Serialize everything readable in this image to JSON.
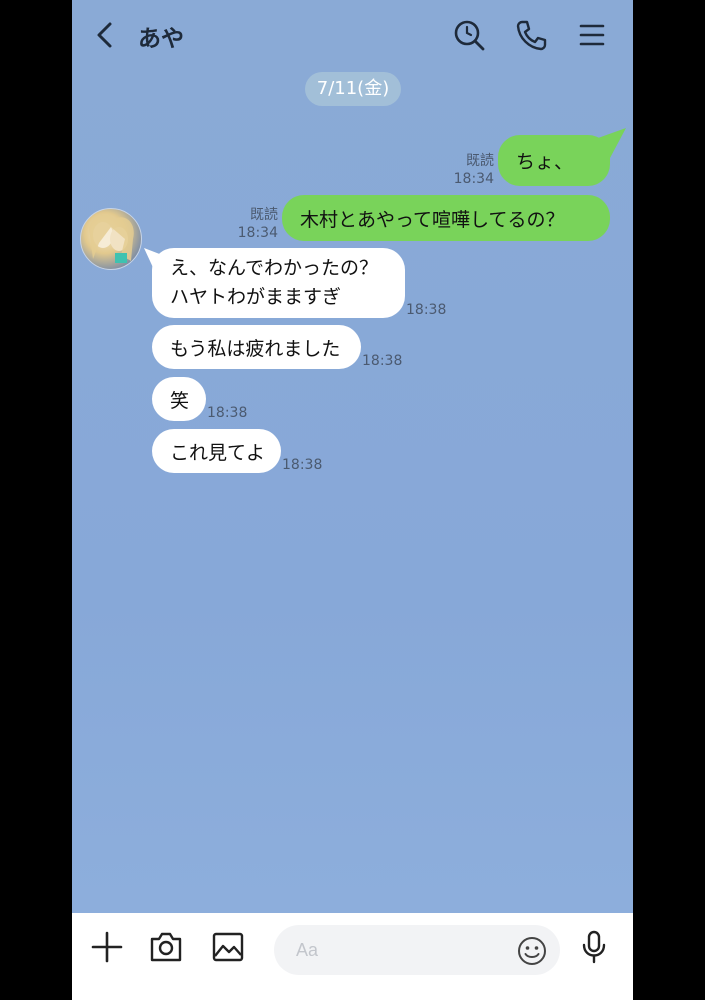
{
  "header": {
    "title": "あや",
    "icons": [
      "back-arrow-icon",
      "search-icon",
      "phone-icon",
      "menu-icon"
    ]
  },
  "date_divider": "7/11(金)",
  "messages": [
    {
      "side": "right",
      "text": "ちょ、",
      "read": "既読",
      "time": "18:34"
    },
    {
      "side": "right",
      "text": "木村とあやって喧嘩してるの？",
      "read": "既読",
      "time": "18:34"
    },
    {
      "side": "left",
      "lines": [
        "え、なんでわかったの？",
        "ハヤトわがまますぎ"
      ],
      "time": "18:38"
    },
    {
      "side": "left",
      "text": "もう私は疲れました",
      "time": "18:38"
    },
    {
      "side": "left",
      "text": "笑",
      "time": "18:38"
    },
    {
      "side": "left",
      "text": "これ見てよ",
      "time": "18:38"
    }
  ],
  "input_bar": {
    "placeholder": "Aa",
    "icons": [
      "plus-icon",
      "camera-icon",
      "image-icon",
      "emoji-icon",
      "microphone-icon"
    ]
  },
  "colors": {
    "background": "#8aaad6",
    "sent_bubble": "#79d35a",
    "received_bubble": "#ffffff",
    "date_pill": "#a2bfd8"
  }
}
